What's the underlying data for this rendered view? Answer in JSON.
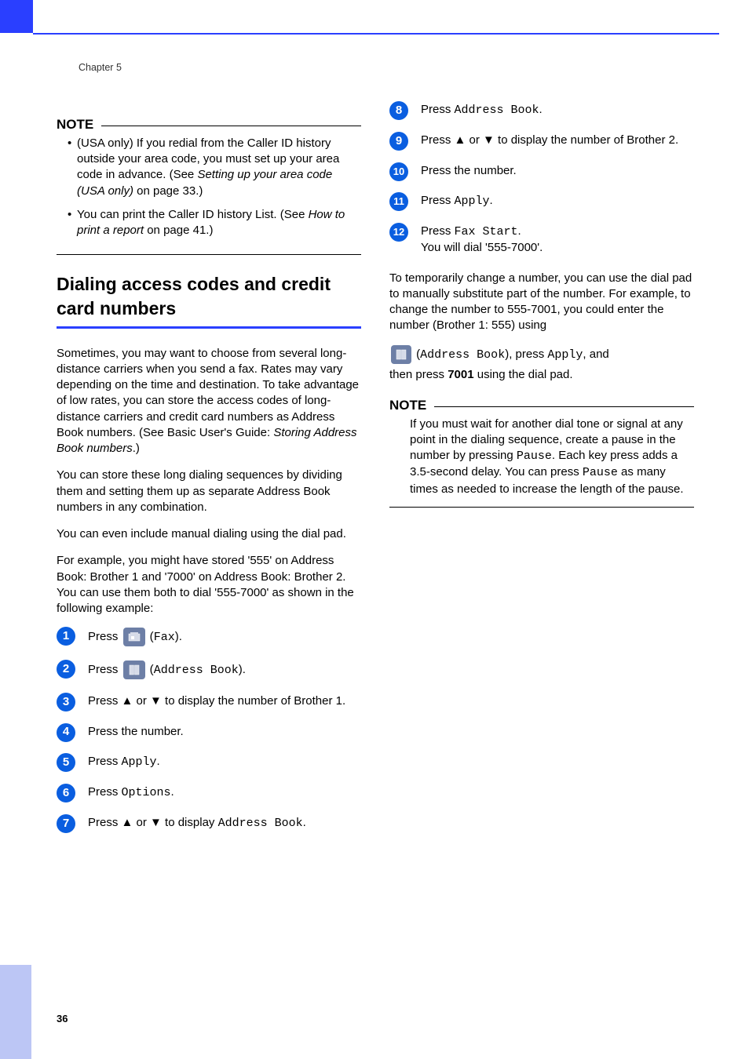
{
  "chapter": "Chapter 5",
  "page_number": "36",
  "left": {
    "note_label": "NOTE",
    "note_items": [
      {
        "lead": "(USA only) If you redial from the Caller ID history outside your area code, you must set up your area code in advance. (See ",
        "italic": "Setting up your area code (USA only)",
        "tail": " on page 33.)"
      },
      {
        "lead": "You can print the Caller ID history List. (See ",
        "italic": "How to print a report",
        "tail": " on page 41.)"
      }
    ],
    "heading": "Dialing access codes and credit card numbers",
    "p1_a": "Sometimes, you may want to choose from several long-distance carriers when you send a fax. Rates may vary depending on the time and destination. To take advantage of low rates, you can store the access codes of long-distance carriers and credit card numbers as Address Book numbers. (See Basic User's Guide: ",
    "p1_italic": "Storing Address Book numbers",
    "p1_b": ".)",
    "p2": "You can store these long dialing sequences by dividing them and setting them up as separate Address Book numbers in any combination.",
    "p3": "You can even include manual dialing using the dial pad.",
    "p4": "For example, you might have stored '555' on Address Book: Brother 1 and '7000' on Address Book: Brother 2. You can use them both to dial '555-7000' as shown in the following example:",
    "steps": {
      "s1_a": "Press ",
      "s1_b": " (",
      "s1_mono": "Fax",
      "s1_c": ").",
      "s2_a": "Press ",
      "s2_b": " (",
      "s2_mono": "Address Book",
      "s2_c": ").",
      "s3": "Press ▲ or ▼ to display the number of Brother 1.",
      "s4": "Press the number.",
      "s5_a": "Press ",
      "s5_mono": "Apply",
      "s5_b": ".",
      "s6_a": "Press ",
      "s6_mono": "Options",
      "s6_b": ".",
      "s7_a": "Press ▲ or ▼ to display ",
      "s7_mono": "Address Book",
      "s7_b": "."
    }
  },
  "right": {
    "steps": {
      "s8_a": "Press ",
      "s8_mono": "Address Book",
      "s8_b": ".",
      "s9": "Press ▲ or ▼ to display the number of Brother 2.",
      "s10": "Press the number.",
      "s11_a": "Press ",
      "s11_mono": "Apply",
      "s11_b": ".",
      "s12_a": "Press ",
      "s12_mono": "Fax Start",
      "s12_b": ".",
      "s12_c": "You will dial '555-7000'."
    },
    "p1": "To temporarily change a number, you can use the dial pad to manually substitute part of the number. For example, to change the number to 555-7001, you could enter the number (Brother 1: 555) using",
    "p2_a": " (",
    "p2_mono1": "Address Book",
    "p2_b": "), press ",
    "p2_mono2": "Apply",
    "p2_c": ", and",
    "p3_a": "then press ",
    "p3_bold": "7001",
    "p3_b": " using the dial pad.",
    "note_label": "NOTE",
    "note_a": "If you must wait for another dial tone or signal at any point in the dialing sequence, create a pause in the number by pressing ",
    "note_mono1": "Pause",
    "note_b": ". Each key press adds a 3.5-second delay. You can press ",
    "note_mono2": "Pause",
    "note_c": " as many times as needed to increase the length of the pause."
  }
}
